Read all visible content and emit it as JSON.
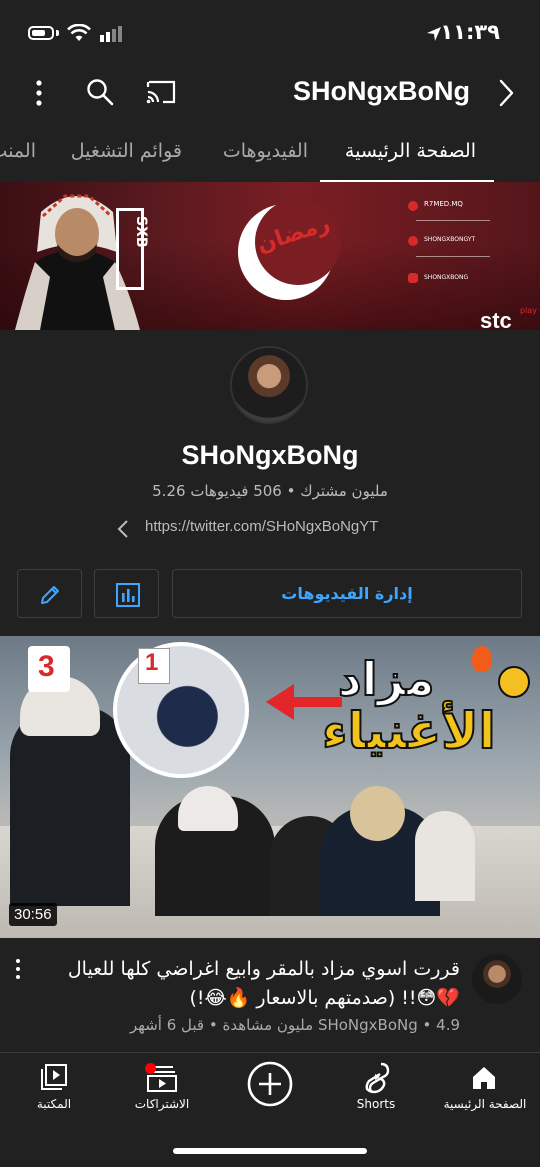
{
  "status": {
    "time": "١١:٣٩"
  },
  "header": {
    "channel_title": "SHoNgxBoNg",
    "icons": [
      "more-vert-icon",
      "search-icon",
      "cast-icon",
      "chevron-right-icon"
    ]
  },
  "tabs": [
    {
      "label": "الصفحة الرئيسية",
      "active": true
    },
    {
      "label": "الفيديوهات",
      "active": false
    },
    {
      "label": "قوائم التشغيل",
      "active": false
    },
    {
      "label": "المنت",
      "active": false
    }
  ],
  "banner": {
    "ramadan_text": "رمضان",
    "handles": [
      "R7MED.MQ",
      "SHONGXBONGYT",
      "SHONGXBONG"
    ],
    "logo_text": "SXB",
    "sponsor": "stc",
    "sponsor_sup": "play"
  },
  "channel": {
    "name": "SHoNgxBoNg",
    "stats": "5.26 مليون مشترك • 506 فيديوهات",
    "link": "https://twitter.com/SHoNgxBoNgYT"
  },
  "actions": {
    "manage_label": "إدارة الفيديوهات"
  },
  "video": {
    "duration": "30:56",
    "title": "قررت اسوي مزاد بالمقر وابيع اغراضي كلها للعيال 💔😳!! (صدمتهم بالاسعار 🔥😂!)",
    "meta": "SHoNgxBoNg • 4.9 مليون مشاهدة • قبل 6 أشهر",
    "thumb_text_1": "مزاد",
    "thumb_text_2": "الأغنياء",
    "paddle_1": "1",
    "paddle_3": "3"
  },
  "bottom_nav": [
    {
      "label": "الصفحة الرئيسية",
      "icon": "home-icon"
    },
    {
      "label": "Shorts",
      "icon": "shorts-icon"
    },
    {
      "label": "",
      "icon": "create-icon"
    },
    {
      "label": "الاشتراكات",
      "icon": "subscriptions-icon"
    },
    {
      "label": "المكتبة",
      "icon": "library-icon"
    }
  ],
  "colors": {
    "background": "#212121",
    "accent": "#3ea6ff",
    "notification": "#ff0000"
  }
}
